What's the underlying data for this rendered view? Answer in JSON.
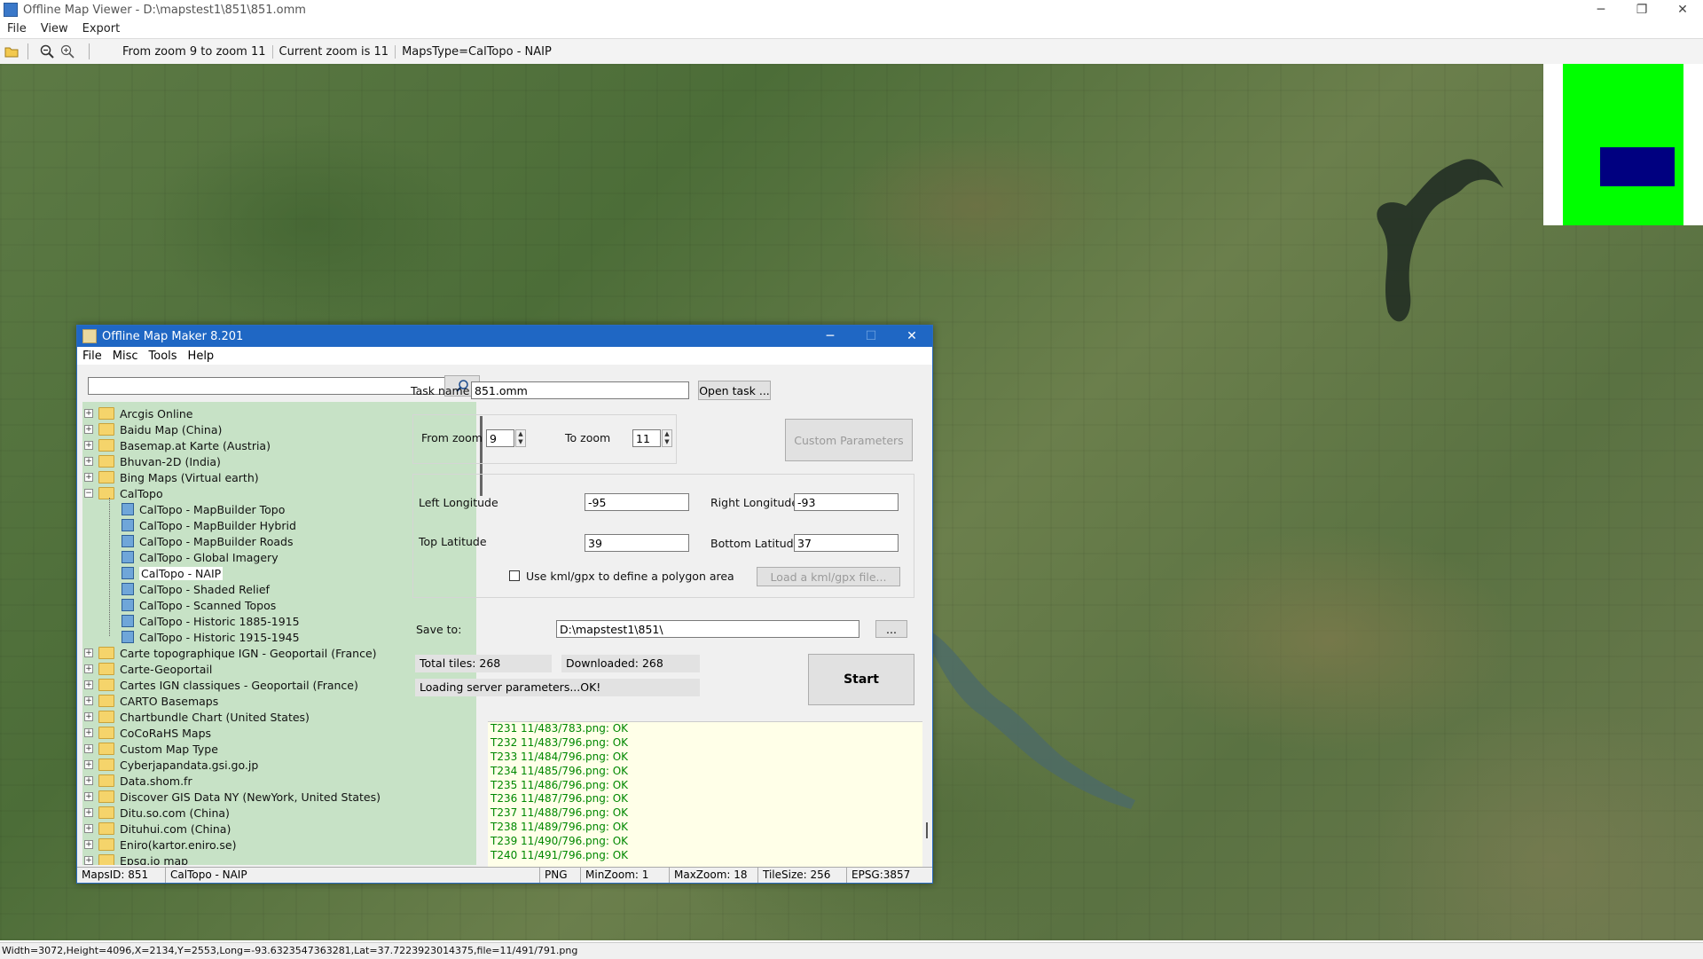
{
  "window": {
    "title": "Offline Map Viewer - D:\\mapstest1\\851\\851.omm",
    "controls": [
      "─",
      "❐",
      "✕"
    ]
  },
  "menu": [
    "File",
    "View",
    "Export"
  ],
  "toolbar": {
    "icons": [
      "folder-open-icon",
      "zoom-out-icon",
      "zoom-in-icon"
    ],
    "zoom_range": "From zoom 9 to zoom 11",
    "current_zoom": "Current zoom is 11",
    "maps_type": "MapsType=CalTopo - NAIP"
  },
  "overview": {
    "colors": {
      "frame": "#00ff00",
      "viewport": "#000080"
    }
  },
  "status_bar": "Width=3072,Height=4096,X=2134,Y=2553,Long=-93.6323547363281,Lat=37.7223923014375,file=11/491/791.png",
  "dialog": {
    "title": "Offline Map Maker 8.201",
    "controls": [
      "─",
      "☐",
      "✕"
    ],
    "menu": [
      "File",
      "Misc",
      "Tools",
      "Help"
    ],
    "search": {
      "value": "",
      "placeholder": ""
    },
    "tree": {
      "folders_before": [
        "Arcgis Online",
        "Baidu Map (China)",
        "Basemap.at Karte (Austria)",
        "Bhuvan-2D (India)",
        "Bing Maps (Virtual earth)"
      ],
      "open_folder": "CalTopo",
      "children": [
        "CalTopo - MapBuilder Topo",
        "CalTopo - MapBuilder Hybrid",
        "CalTopo - MapBuilder Roads",
        "CalTopo - Global Imagery",
        "CalTopo - NAIP",
        "CalTopo - Shaded Relief",
        "CalTopo - Scanned Topos",
        "CalTopo - Historic 1885-1915",
        "CalTopo - Historic 1915-1945"
      ],
      "selected": "CalTopo - NAIP",
      "folders_after": [
        "Carte topographique IGN - Geoportail (France)",
        "Carte-Geoportail",
        "Cartes IGN classiques - Geoportail (France)",
        "CARTO Basemaps",
        "Chartbundle Chart (United States)",
        "CoCoRaHS Maps",
        "Custom Map Type",
        "Cyberjapandata.gsi.go.jp",
        "Data.shom.fr",
        "Discover GIS Data NY (NewYork, United States)",
        "Ditu.so.com (China)",
        "Dituhui.com (China)",
        "Eniro(kartor.eniro.se)",
        "Epsg.io map"
      ]
    },
    "task": {
      "label": "Task name",
      "value": "851.omm",
      "open_button": "Open task ..."
    },
    "zoom": {
      "from_label": "From zoom",
      "from_value": "9",
      "to_label": "To zoom",
      "to_value": "11",
      "custom_button": "Custom Parameters"
    },
    "bounds": {
      "left_label": "Left Longitude",
      "left_value": "-95",
      "right_label": "Right Longitude",
      "right_value": "-93",
      "top_label": "Top Latitude",
      "top_value": "39",
      "bottom_label": "Bottom Latitude",
      "bottom_value": "37",
      "kml_label": "Use kml/gpx to define a polygon area",
      "kml_button": "Load a kml/gpx file..."
    },
    "save": {
      "label": "Save to:",
      "value": "D:\\mapstest1\\851\\",
      "browse": "..."
    },
    "progress": {
      "total": "Total tiles: 268",
      "downloaded": "Downloaded: 268",
      "status": "Loading server parameters...OK!",
      "start_button": "Start"
    },
    "log": [
      "T231 11/483/783.png: OK",
      "T232 11/483/796.png: OK",
      "T233 11/484/796.png: OK",
      "T234 11/485/796.png: OK",
      "T235 11/486/796.png: OK",
      "T236 11/487/796.png: OK",
      "T237 11/488/796.png: OK",
      "T238 11/489/796.png: OK",
      "T239 11/490/796.png: OK",
      "T240 11/491/796.png: OK"
    ],
    "status": {
      "maps_id": "MapsID: 851",
      "maps_name": "CalTopo - NAIP",
      "format": "PNG",
      "min_zoom": "MinZoom: 1",
      "max_zoom": "MaxZoom: 18",
      "tile_size": "TileSize: 256",
      "epsg": "EPSG:3857"
    }
  }
}
